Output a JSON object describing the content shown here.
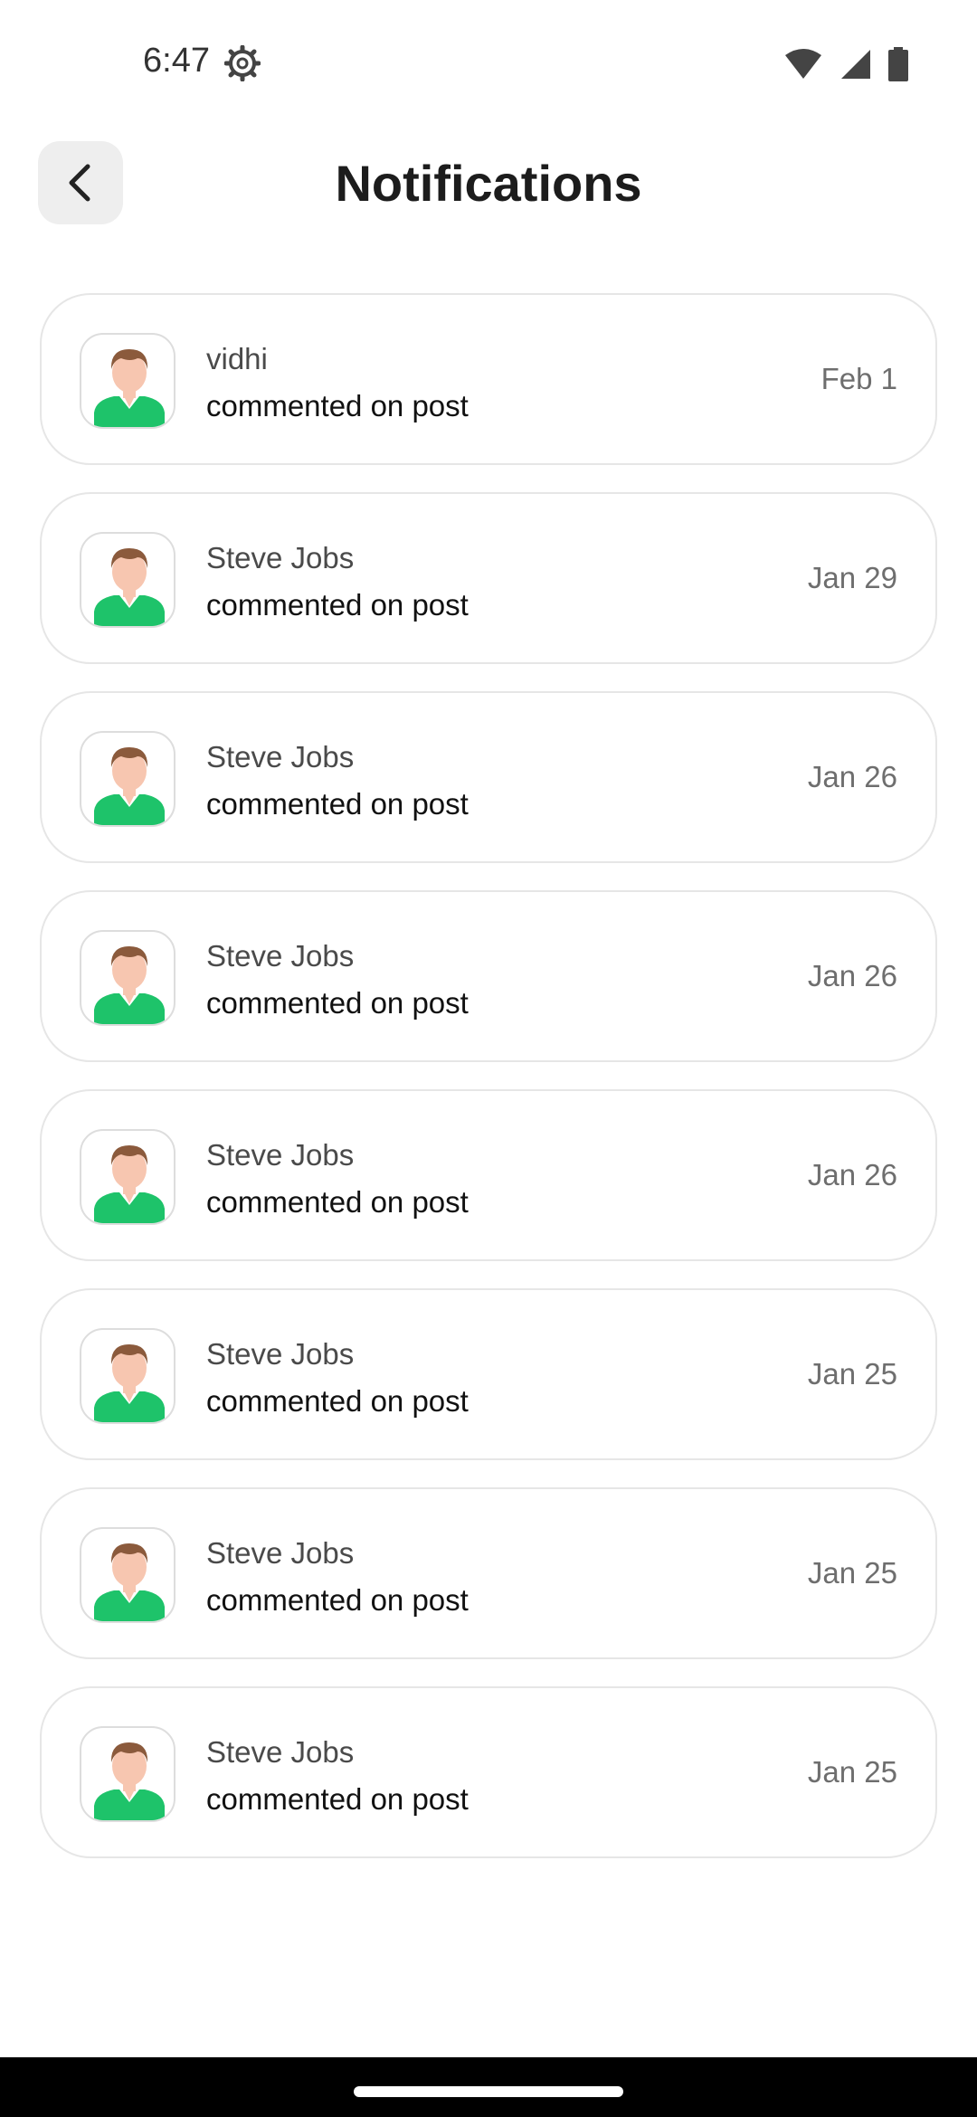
{
  "status_bar": {
    "time": "6:47",
    "icons": [
      "gear-icon",
      "wifi-icon",
      "signal-icon",
      "battery-icon"
    ]
  },
  "header": {
    "back_icon": "chevron-left-icon",
    "title": "Notifications"
  },
  "notifications": [
    {
      "name": "vidhi",
      "action": "commented on post",
      "date": "Feb 1"
    },
    {
      "name": "Steve Jobs",
      "action": "commented on post",
      "date": "Jan 29"
    },
    {
      "name": "Steve Jobs",
      "action": "commented on post",
      "date": "Jan 26"
    },
    {
      "name": "Steve Jobs",
      "action": "commented on post",
      "date": "Jan 26"
    },
    {
      "name": "Steve Jobs",
      "action": "commented on post",
      "date": "Jan 26"
    },
    {
      "name": "Steve Jobs",
      "action": "commented on post",
      "date": "Jan 25"
    },
    {
      "name": "Steve Jobs",
      "action": "commented on post",
      "date": "Jan 25"
    },
    {
      "name": "Steve Jobs",
      "action": "commented on post",
      "date": "Jan 25"
    }
  ],
  "colors": {
    "avatar_shirt": "#1ec36a",
    "avatar_skin": "#f7c6b0",
    "avatar_hair": "#8b5a3c",
    "card_border": "#e6e6e6"
  }
}
